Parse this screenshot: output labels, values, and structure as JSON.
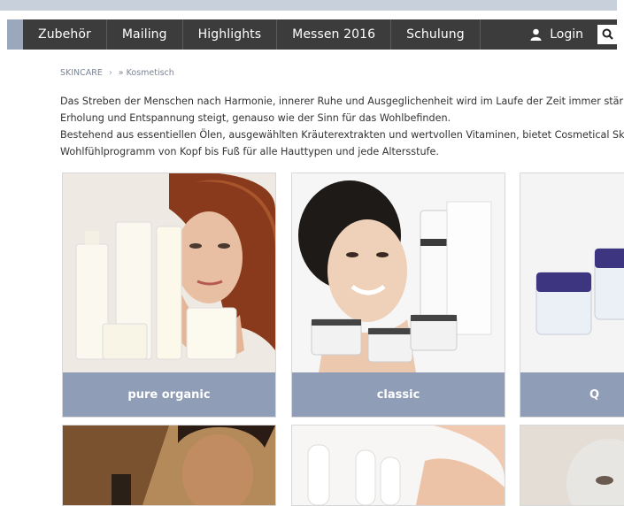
{
  "nav": {
    "items": [
      "Zubehör",
      "Mailing",
      "Highlights",
      "Messen 2016",
      "Schulung"
    ],
    "login_label": "Login"
  },
  "breadcrumb": {
    "root": "SKINCARE",
    "arrow": "›",
    "separator": "»",
    "current": "Kosmetisch"
  },
  "intro": {
    "lines": [
      "Das Streben der Menschen nach Harmonie, innerer Ruhe und Ausgeglichenheit wird im Laufe der Zeit immer stärk",
      "Erholung und Entspannung steigt, genauso wie der Sinn für das Wohlbefinden.",
      "Bestehend aus essentiellen Ölen, ausgewählten Kräuterextrakten und wertvollen Vitaminen, bietet Cosmetical Ski",
      "Wohlfühlprogramm von Kopf bis Fuß für alle Hauttypen und jede Altersstufe."
    ]
  },
  "products": [
    {
      "label": "pure organic"
    },
    {
      "label": "classic"
    },
    {
      "label": "Q"
    }
  ],
  "colors": {
    "nav_bg": "#3c3c3c",
    "accent": "#9aa7bd",
    "label_bg": "#8f9db7"
  }
}
